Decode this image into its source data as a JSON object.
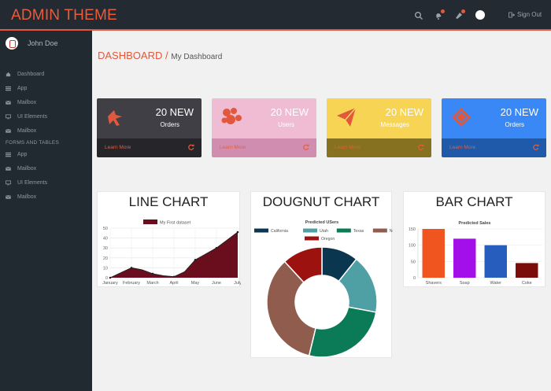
{
  "app": {
    "brand": "ADMIN THEME"
  },
  "topbar": {
    "signout_label": "Sign Out"
  },
  "sidebar": {
    "username": "John Doe",
    "items": [
      {
        "label": "Dashboard",
        "icon": "home-icon"
      },
      {
        "label": "App",
        "icon": "list-icon"
      },
      {
        "label": "Mailbox",
        "icon": "envelope-icon"
      },
      {
        "label": "UI Elements",
        "icon": "monitor-icon"
      },
      {
        "label": "Mailbox",
        "icon": "envelope-icon"
      }
    ],
    "section_label": "FORMS AND TABLES",
    "section_items": [
      {
        "label": "App",
        "icon": "list-icon"
      },
      {
        "label": "Mailbox",
        "icon": "envelope-icon"
      },
      {
        "label": "UI Elements",
        "icon": "monitor-icon"
      },
      {
        "label": "Mailbox",
        "icon": "envelope-icon"
      }
    ]
  },
  "page": {
    "title": "DASHBOARD",
    "separator": "/",
    "subtitle": "My Dashboard"
  },
  "cards": [
    {
      "count": "20 NEW",
      "label": "Orders",
      "more": "Learn More",
      "color": "#3f3f45",
      "foot": "#25252a",
      "icon": "cursor-icon"
    },
    {
      "count": "20 NEW",
      "label": "Users",
      "more": "Learn More",
      "color": "#f0bcd4",
      "foot": "#d08db0",
      "icon": "users-icon"
    },
    {
      "count": "20 NEW",
      "label": "Messages",
      "more": "Learn More",
      "color": "#f7d454",
      "foot": "#85711f",
      "icon": "paper-plane-icon"
    },
    {
      "count": "20 NEW",
      "label": "Orders",
      "more": "Learn More",
      "color": "#3a88f5",
      "foot": "#1e5aa9",
      "icon": "tag-icon"
    }
  ],
  "panels": {
    "line_title": "LINE CHART",
    "doughnut_title": "DOUGNUT CHART",
    "bar_title": "BAR CHART"
  },
  "chart_data": [
    {
      "type": "area",
      "title": "",
      "categories": [
        "January",
        "February",
        "March",
        "April",
        "May",
        "June",
        "July"
      ],
      "x": [
        "January",
        "",
        "February",
        "",
        "March",
        "",
        "April",
        "",
        "May",
        "",
        "June",
        "",
        "July"
      ],
      "series": [
        {
          "name": "My First dataset",
          "values": [
            0,
            5,
            10,
            8,
            4,
            2,
            1,
            6,
            18,
            24,
            30,
            38,
            46
          ],
          "color": "#6a0d1c"
        }
      ],
      "ylim": [
        0,
        50
      ],
      "yticks": [
        0,
        10,
        20,
        30,
        40,
        50
      ],
      "grid": true,
      "legend": "top"
    },
    {
      "type": "pie",
      "title": "Predicted USers",
      "categories": [
        "California",
        "Utah",
        "Texas",
        "Nevada",
        "Oregon"
      ],
      "values": [
        50,
        80,
        120,
        160,
        55
      ],
      "colors": [
        "#0b3650",
        "#4fa0a4",
        "#0a7a57",
        "#8f5c4e",
        "#9b120f"
      ],
      "legend": "top"
    },
    {
      "type": "bar",
      "title": "Predicted Sales",
      "categories": [
        "Shavers",
        "Soap",
        "Water",
        "Coke"
      ],
      "values": [
        150,
        120,
        100,
        45
      ],
      "colors": [
        "#f0541f",
        "#a20fe8",
        "#275ebd",
        "#7a0c0a"
      ],
      "ylim": [
        0,
        150
      ],
      "yticks": [
        0,
        50,
        100,
        150
      ],
      "grid": true
    }
  ]
}
